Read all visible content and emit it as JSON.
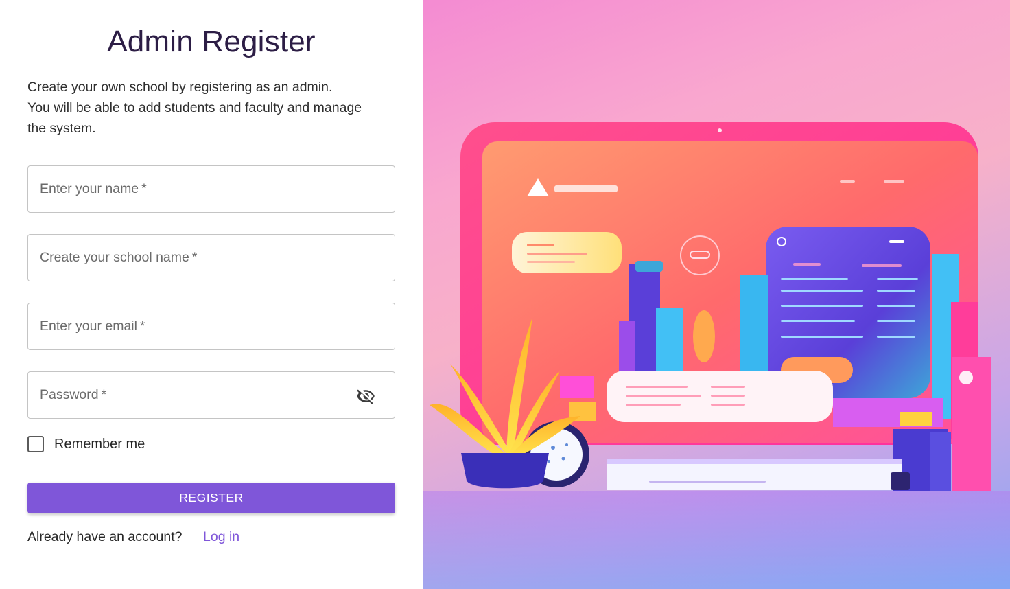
{
  "page": {
    "title": "Admin Register",
    "intro_lines": [
      "Create your own school by registering as an admin.",
      "You will be able to add students and faculty and manage",
      "the system."
    ]
  },
  "form": {
    "name_placeholder": "Enter your name",
    "school_placeholder": "Create your school name",
    "email_placeholder": "Enter your email",
    "password_placeholder": "Password",
    "required_mark": "*",
    "password_toggle_icon": "eye-off-icon",
    "remember_label": "Remember me",
    "remember_checked": false,
    "register_label": "REGISTER"
  },
  "footer": {
    "account_text": "Already have an account?",
    "login_label": "Log in"
  },
  "colors": {
    "accent": "#7f56d9",
    "title": "#2c1d45"
  },
  "illustration": {
    "type": "laptop-dashboard-illustration"
  }
}
